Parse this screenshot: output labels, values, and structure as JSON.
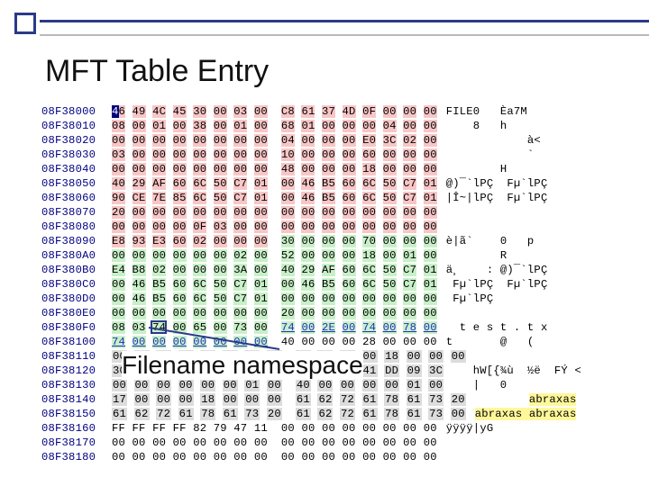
{
  "title": "MFT Table Entry",
  "callout": "Filename namespace",
  "rows": [
    {
      "offset": "08F38000",
      "hex": "46 49 4C 45 30 00 03 00  C8 61 37 4D 0F 00 00 00",
      "hl": "pink",
      "first_inv": true,
      "ascii": "FILE0   Èa7M"
    },
    {
      "offset": "08F38010",
      "hex": "08 00 01 00 38 00 01 00  68 01 00 00 00 04 00 00",
      "hl": "pink",
      "ascii": "    8   h"
    },
    {
      "offset": "08F38020",
      "hex": "00 00 00 00 00 00 00 00  04 00 00 00 E0 3C 02 00",
      "hl": "pink",
      "ascii": "            à<"
    },
    {
      "offset": "08F38030",
      "hex": "03 00 00 00 00 00 00 00  10 00 00 00 60 00 00 00",
      "hl": "pink",
      "ascii": "            `"
    },
    {
      "offset": "08F38040",
      "hex": "00 00 00 00 00 00 00 00  48 00 00 00 18 00 00 00",
      "hl": "pink",
      "ascii": "        H"
    },
    {
      "offset": "08F38050",
      "hex": "40 29 AF 60 6C 50 C7 01  00 46 B5 60 6C 50 C7 01",
      "hl": "pink",
      "ascii": "@)¯`lPÇ  Fµ`lPÇ"
    },
    {
      "offset": "08F38060",
      "hex": "90 CE 7E 85 6C 50 C7 01  00 46 B5 60 6C 50 C7 01",
      "hl": "pink",
      "ascii": "|Î~|lPÇ  Fµ`lPÇ"
    },
    {
      "offset": "08F38070",
      "hex": "20 00 00 00 00 00 00 00  00 00 00 00 00 00 00 00",
      "hl": "pink",
      "ascii": ""
    },
    {
      "offset": "08F38080",
      "hex": "00 00 00 00 0F 03 00 00  00 00 00 00 00 00 00 00",
      "hl": "pink",
      "ascii": ""
    },
    {
      "offset": "08F38090",
      "hex": "E8 93 E3 60 02 00 00 00  30 00 00 00 70 00 00 00",
      "hl": "pink",
      "pink_cols": 8,
      "post_hl": "green",
      "ascii": "è|ã`    0   p"
    },
    {
      "offset": "08F380A0",
      "hex": "00 00 00 00 00 00 02 00  52 00 00 00 18 00 01 00",
      "hl": "green",
      "ascii": "        R"
    },
    {
      "offset": "08F380B0",
      "hex": "E4 B8 02 00 00 00 3A 00  40 29 AF 60 6C 50 C7 01",
      "hl": "green",
      "ascii": "ä¸    : @)¯`lPÇ"
    },
    {
      "offset": "08F380C0",
      "hex": "00 46 B5 60 6C 50 C7 01  00 46 B5 60 6C 50 C7 01",
      "hl": "green",
      "ascii": " Fµ`lPÇ  Fµ`lPÇ"
    },
    {
      "offset": "08F380D0",
      "hex": "00 46 B5 60 6C 50 C7 01  00 00 00 00 00 00 00 00",
      "hl": "green",
      "ascii": " Fµ`lPÇ"
    },
    {
      "offset": "08F380E0",
      "hex": "00 00 00 00 00 00 00 00  20 00 00 00 00 00 00 00",
      "hl": "green",
      "ascii": ""
    },
    {
      "offset": "08F380F0",
      "hex": "08 03 74 00 65 00 73 00  74 00 2E 00 74 00 78 00",
      "hl": "green",
      "boxed_col": 2,
      "ascii": "  t e s t . t x",
      "ul_second_half": true
    },
    {
      "offset": "08F38100",
      "hex": "74 00 00 00 00 00 00 00  40 00 00 00 28 00 00 00",
      "hl": "green",
      "green_cols": 8,
      "ul_first_half": true,
      "ascii": "t       @   ("
    },
    {
      "offset": "08F38110",
      "hex": "00 00 00 00 00 00 03 00  10 00 00 00 18 00 00 00",
      "gray": true,
      "ascii": ""
    },
    {
      "offset": "08F38120",
      "hex": "30 45 37 46 35 45 30 37  2D 33 32 41 DD 09 3C   ",
      "gray": true,
      "ascii": "hW[{¾ù  ½ë  FÝ <"
    },
    {
      "offset": "08F38130",
      "hex": "00 00 00 00 00 00 01 00  40 00 00 00 00 01 00   ",
      "gray": true,
      "ascii": "|   0"
    },
    {
      "offset": "08F38140",
      "hex": "17 00 00 00 18 00 00 00  61 62 72 61 78 61 73 20",
      "gray": true,
      "ascii": "        abraxas",
      "ascii_hl": "yellow",
      "ascii_hl_start": 8
    },
    {
      "offset": "08F38150",
      "hex": "61 62 72 61 78 61 73 20  61 62 72 61 78 61 73 00",
      "gray": true,
      "ascii": "abraxas abraxas",
      "ascii_hl": "yellow"
    },
    {
      "offset": "08F38160",
      "hex": "FF FF FF FF 82 79 47 11  00 00 00 00 00 00 00 00",
      "ascii": "ÿÿÿÿ|yG"
    },
    {
      "offset": "08F38170",
      "hex": "00 00 00 00 00 00 00 00  00 00 00 00 00 00 00 00",
      "ascii": ""
    },
    {
      "offset": "08F38180",
      "hex": "00 00 00 00 00 00 00 00  00 00 00 00 00 00 00 00",
      "ascii": ""
    }
  ]
}
